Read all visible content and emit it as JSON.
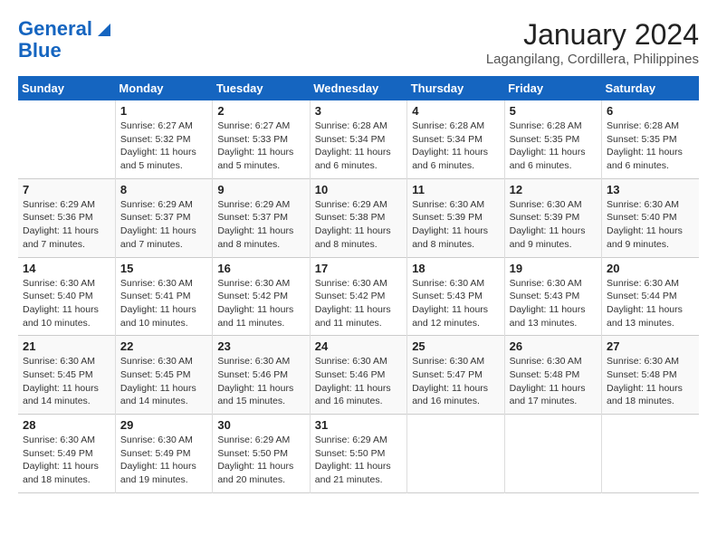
{
  "header": {
    "logo_line1": "General",
    "logo_line2": "Blue",
    "main_title": "January 2024",
    "subtitle": "Lagangilang, Cordillera, Philippines"
  },
  "calendar": {
    "days_of_week": [
      "Sunday",
      "Monday",
      "Tuesday",
      "Wednesday",
      "Thursday",
      "Friday",
      "Saturday"
    ],
    "weeks": [
      [
        {
          "day": "",
          "info": ""
        },
        {
          "day": "1",
          "info": "Sunrise: 6:27 AM\nSunset: 5:32 PM\nDaylight: 11 hours\nand 5 minutes."
        },
        {
          "day": "2",
          "info": "Sunrise: 6:27 AM\nSunset: 5:33 PM\nDaylight: 11 hours\nand 5 minutes."
        },
        {
          "day": "3",
          "info": "Sunrise: 6:28 AM\nSunset: 5:34 PM\nDaylight: 11 hours\nand 6 minutes."
        },
        {
          "day": "4",
          "info": "Sunrise: 6:28 AM\nSunset: 5:34 PM\nDaylight: 11 hours\nand 6 minutes."
        },
        {
          "day": "5",
          "info": "Sunrise: 6:28 AM\nSunset: 5:35 PM\nDaylight: 11 hours\nand 6 minutes."
        },
        {
          "day": "6",
          "info": "Sunrise: 6:28 AM\nSunset: 5:35 PM\nDaylight: 11 hours\nand 6 minutes."
        }
      ],
      [
        {
          "day": "7",
          "info": "Sunrise: 6:29 AM\nSunset: 5:36 PM\nDaylight: 11 hours\nand 7 minutes."
        },
        {
          "day": "8",
          "info": "Sunrise: 6:29 AM\nSunset: 5:37 PM\nDaylight: 11 hours\nand 7 minutes."
        },
        {
          "day": "9",
          "info": "Sunrise: 6:29 AM\nSunset: 5:37 PM\nDaylight: 11 hours\nand 8 minutes."
        },
        {
          "day": "10",
          "info": "Sunrise: 6:29 AM\nSunset: 5:38 PM\nDaylight: 11 hours\nand 8 minutes."
        },
        {
          "day": "11",
          "info": "Sunrise: 6:30 AM\nSunset: 5:39 PM\nDaylight: 11 hours\nand 8 minutes."
        },
        {
          "day": "12",
          "info": "Sunrise: 6:30 AM\nSunset: 5:39 PM\nDaylight: 11 hours\nand 9 minutes."
        },
        {
          "day": "13",
          "info": "Sunrise: 6:30 AM\nSunset: 5:40 PM\nDaylight: 11 hours\nand 9 minutes."
        }
      ],
      [
        {
          "day": "14",
          "info": "Sunrise: 6:30 AM\nSunset: 5:40 PM\nDaylight: 11 hours\nand 10 minutes."
        },
        {
          "day": "15",
          "info": "Sunrise: 6:30 AM\nSunset: 5:41 PM\nDaylight: 11 hours\nand 10 minutes."
        },
        {
          "day": "16",
          "info": "Sunrise: 6:30 AM\nSunset: 5:42 PM\nDaylight: 11 hours\nand 11 minutes."
        },
        {
          "day": "17",
          "info": "Sunrise: 6:30 AM\nSunset: 5:42 PM\nDaylight: 11 hours\nand 11 minutes."
        },
        {
          "day": "18",
          "info": "Sunrise: 6:30 AM\nSunset: 5:43 PM\nDaylight: 11 hours\nand 12 minutes."
        },
        {
          "day": "19",
          "info": "Sunrise: 6:30 AM\nSunset: 5:43 PM\nDaylight: 11 hours\nand 13 minutes."
        },
        {
          "day": "20",
          "info": "Sunrise: 6:30 AM\nSunset: 5:44 PM\nDaylight: 11 hours\nand 13 minutes."
        }
      ],
      [
        {
          "day": "21",
          "info": "Sunrise: 6:30 AM\nSunset: 5:45 PM\nDaylight: 11 hours\nand 14 minutes."
        },
        {
          "day": "22",
          "info": "Sunrise: 6:30 AM\nSunset: 5:45 PM\nDaylight: 11 hours\nand 14 minutes."
        },
        {
          "day": "23",
          "info": "Sunrise: 6:30 AM\nSunset: 5:46 PM\nDaylight: 11 hours\nand 15 minutes."
        },
        {
          "day": "24",
          "info": "Sunrise: 6:30 AM\nSunset: 5:46 PM\nDaylight: 11 hours\nand 16 minutes."
        },
        {
          "day": "25",
          "info": "Sunrise: 6:30 AM\nSunset: 5:47 PM\nDaylight: 11 hours\nand 16 minutes."
        },
        {
          "day": "26",
          "info": "Sunrise: 6:30 AM\nSunset: 5:48 PM\nDaylight: 11 hours\nand 17 minutes."
        },
        {
          "day": "27",
          "info": "Sunrise: 6:30 AM\nSunset: 5:48 PM\nDaylight: 11 hours\nand 18 minutes."
        }
      ],
      [
        {
          "day": "28",
          "info": "Sunrise: 6:30 AM\nSunset: 5:49 PM\nDaylight: 11 hours\nand 18 minutes."
        },
        {
          "day": "29",
          "info": "Sunrise: 6:30 AM\nSunset: 5:49 PM\nDaylight: 11 hours\nand 19 minutes."
        },
        {
          "day": "30",
          "info": "Sunrise: 6:29 AM\nSunset: 5:50 PM\nDaylight: 11 hours\nand 20 minutes."
        },
        {
          "day": "31",
          "info": "Sunrise: 6:29 AM\nSunset: 5:50 PM\nDaylight: 11 hours\nand 21 minutes."
        },
        {
          "day": "",
          "info": ""
        },
        {
          "day": "",
          "info": ""
        },
        {
          "day": "",
          "info": ""
        }
      ]
    ]
  }
}
